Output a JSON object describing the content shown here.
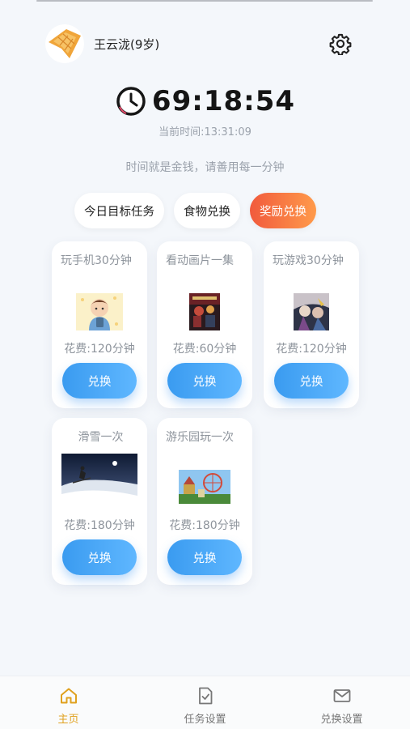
{
  "user": {
    "name": "王云泷(9岁)"
  },
  "timer": {
    "remaining": "69:18:54",
    "current_time": "当前时间:13:31:09"
  },
  "motto": "时间就是金钱，请善用每一分钟",
  "tabs": [
    {
      "label": "今日目标任务",
      "active": false
    },
    {
      "label": "食物兑换",
      "active": false
    },
    {
      "label": "奖励兑换",
      "active": true
    }
  ],
  "rewards": [
    {
      "title": "玩手机30分钟",
      "cost": "花费:120分钟",
      "button": "兑换",
      "image": "cartoon-boy-phone"
    },
    {
      "title": "看动画片一集",
      "cost": "花费:60分钟",
      "button": "兑换",
      "image": "cartoon-poster"
    },
    {
      "title": "玩游戏30分钟",
      "cost": "花费:120分钟",
      "button": "兑换",
      "image": "game-art"
    },
    {
      "title": "滑雪一次",
      "cost": "花费:180分钟",
      "button": "兑换",
      "image": "skier-photo"
    },
    {
      "title": "游乐园玩一次",
      "cost": "花费:180分钟",
      "button": "兑换",
      "image": "amusement-park-photo"
    }
  ],
  "nav": [
    {
      "label": "主页",
      "icon": "home-icon",
      "active": true
    },
    {
      "label": "任务设置",
      "icon": "task-check-icon",
      "active": false
    },
    {
      "label": "兑换设置",
      "icon": "mail-icon",
      "active": false
    }
  ],
  "colors": {
    "accent_orange": "#f15a3d",
    "button_blue": "#3a9bf0",
    "nav_active": "#e0a11f",
    "background": "#f4f7fb"
  }
}
